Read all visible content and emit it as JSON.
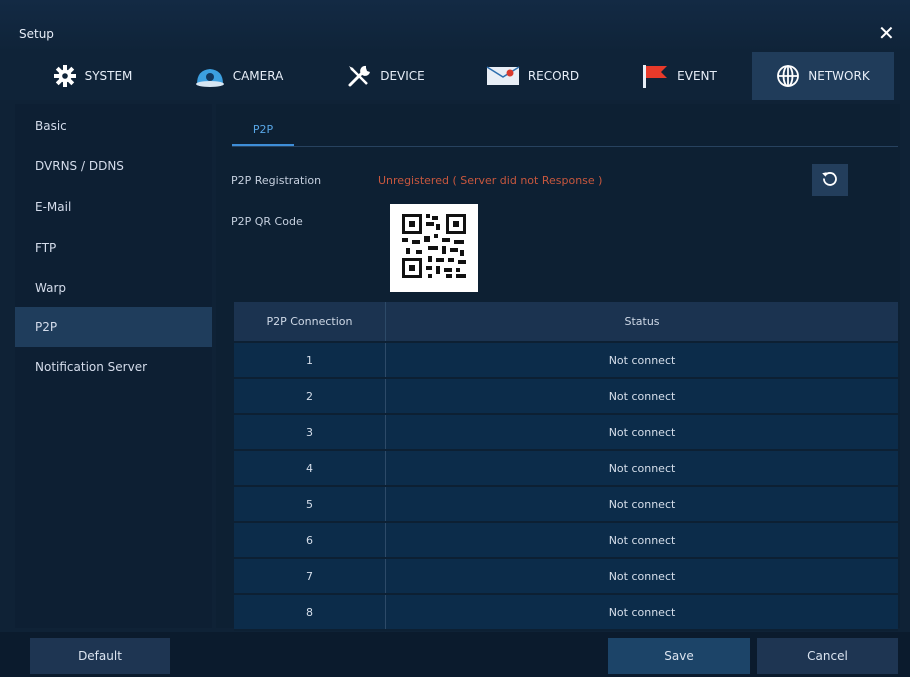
{
  "window": {
    "title": "Setup",
    "close_symbol": "✕"
  },
  "tabs": [
    {
      "label": "SYSTEM",
      "icon": "gear-icon"
    },
    {
      "label": "CAMERA",
      "icon": "camera-icon"
    },
    {
      "label": "DEVICE",
      "icon": "tools-icon"
    },
    {
      "label": "RECORD",
      "icon": "record-icon"
    },
    {
      "label": "EVENT",
      "icon": "flag-icon"
    },
    {
      "label": "NETWORK",
      "icon": "globe-icon",
      "active": true
    }
  ],
  "sidebar": {
    "items": [
      {
        "label": "Basic"
      },
      {
        "label": "DVRNS / DDNS"
      },
      {
        "label": "E-Mail"
      },
      {
        "label": "FTP"
      },
      {
        "label": "Warp"
      },
      {
        "label": "P2P",
        "active": true
      },
      {
        "label": "Notification Server"
      }
    ]
  },
  "content": {
    "subtab": "P2P",
    "registration_label": "P2P Registration",
    "registration_status": "Unregistered ( Server did not Response )",
    "qr_label": "P2P QR Code",
    "table": {
      "headers": [
        "P2P Connection",
        "Status"
      ],
      "rows": [
        {
          "id": "1",
          "status": "Not connect"
        },
        {
          "id": "2",
          "status": "Not connect"
        },
        {
          "id": "3",
          "status": "Not connect"
        },
        {
          "id": "4",
          "status": "Not connect"
        },
        {
          "id": "5",
          "status": "Not connect"
        },
        {
          "id": "6",
          "status": "Not connect"
        },
        {
          "id": "7",
          "status": "Not connect"
        },
        {
          "id": "8",
          "status": "Not connect"
        }
      ]
    }
  },
  "footer": {
    "default_label": "Default",
    "save_label": "Save",
    "cancel_label": "Cancel"
  },
  "colors": {
    "accent": "#3e8ed8",
    "status_error": "#c7573e",
    "panel": "#0d2033"
  }
}
